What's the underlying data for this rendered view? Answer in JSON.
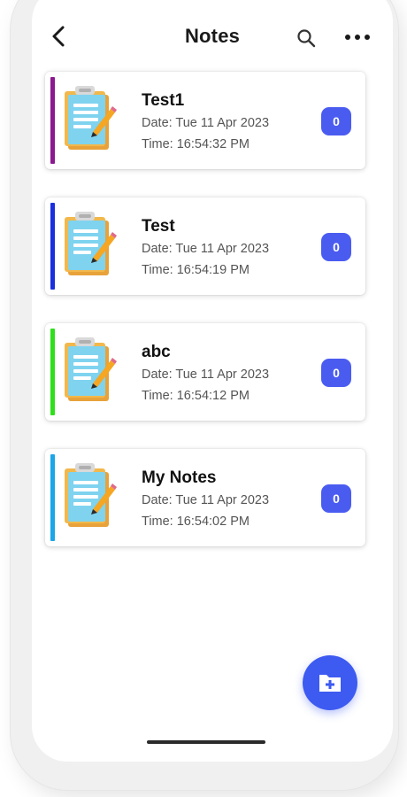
{
  "header": {
    "title": "Notes",
    "back_icon": "chevron-left-icon",
    "search_icon": "search-icon",
    "more_icon": "more-horizontal-icon"
  },
  "notes": [
    {
      "name": "Test1",
      "date": "Date: Tue 11 Apr 2023",
      "time": "Time: 16:54:32 PM",
      "count": "0",
      "accent_color": "#8b1a8f"
    },
    {
      "name": "Test",
      "date": "Date: Tue 11 Apr 2023",
      "time": "Time: 16:54:19 PM",
      "count": "0",
      "accent_color": "#1b2fe0"
    },
    {
      "name": "abc",
      "date": "Date: Tue 11 Apr 2023",
      "time": "Time: 16:54:12 PM",
      "count": "0",
      "accent_color": "#2ee01b"
    },
    {
      "name": "My Notes",
      "date": "Date: Tue 11 Apr 2023",
      "time": "Time: 16:54:02 PM",
      "count": "0",
      "accent_color": "#1ba6e8"
    }
  ],
  "fab": {
    "icon": "add-folder-icon"
  },
  "colors": {
    "badge": "#4a5cf0",
    "fab": "#3d5af1"
  }
}
